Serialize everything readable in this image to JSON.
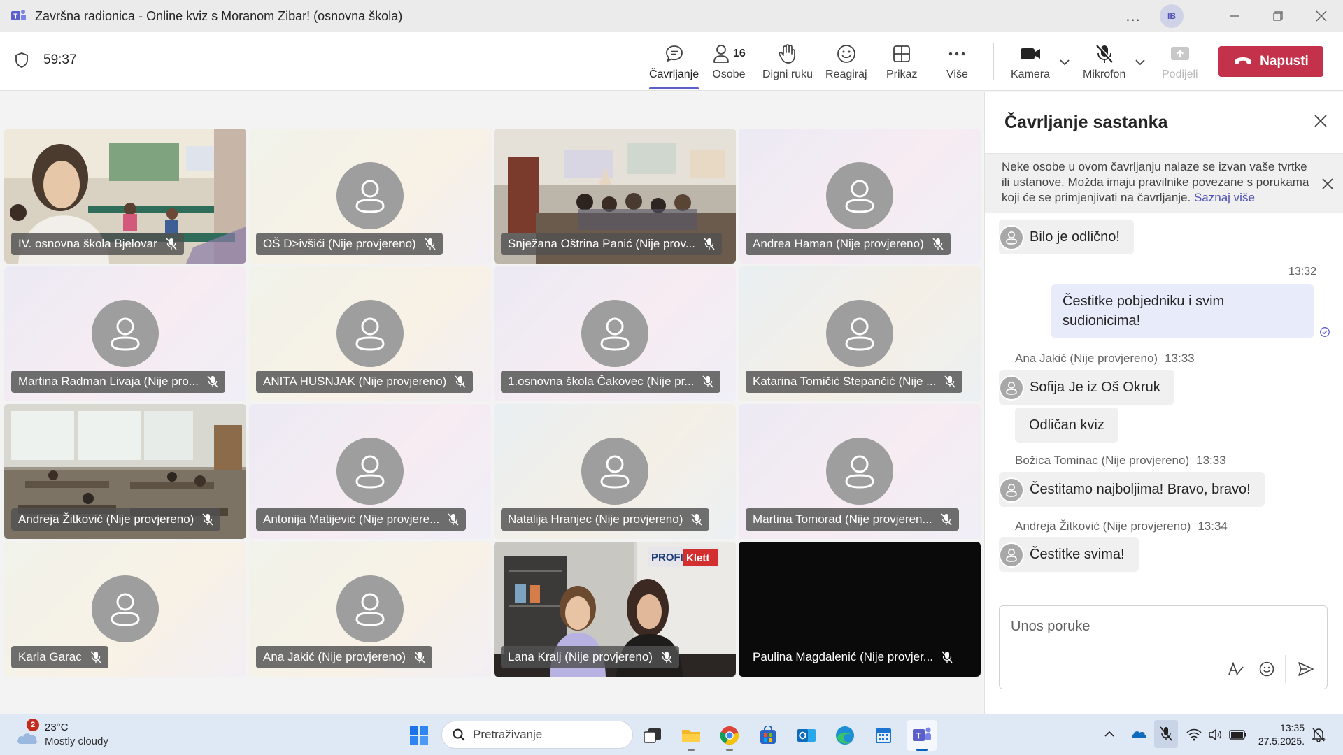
{
  "window": {
    "title": "Završna radionica - Online kviz s Moranom Zibar! (osnovna škola)",
    "more_label": "...",
    "user_initials": "IB"
  },
  "toolbar": {
    "timer": "59:37",
    "chat_label": "Čavrljanje",
    "people_label": "Osobe",
    "people_count": "16",
    "raise_hand_label": "Digni ruku",
    "react_label": "Reagiraj",
    "view_label": "Prikaz",
    "more_label": "Više",
    "camera_label": "Kamera",
    "mic_label": "Mikrofon",
    "share_label": "Podijeli",
    "leave_label": "Napusti"
  },
  "colors": {
    "accent": "#5b5fc7",
    "leave": "#c4314b",
    "bubble_out": "#e8ebfa"
  },
  "participants": [
    {
      "name": "IV. osnovna škola Bjelovar",
      "video": true
    },
    {
      "name": "OŠ D>ivšići (Nije provjereno)",
      "video": false
    },
    {
      "name": "Snježana Oštrina Panić (Nije prov...",
      "video": true
    },
    {
      "name": "Andrea Haman (Nije provjereno)",
      "video": false
    },
    {
      "name": "Martina Radman Livaja (Nije pro...",
      "video": false
    },
    {
      "name": "ANITA HUSNJAK (Nije provjereno)",
      "video": false
    },
    {
      "name": "1.osnovna škola Čakovec (Nije pr...",
      "video": false
    },
    {
      "name": "Katarina Tomičić Stepančić (Nije ...",
      "video": false
    },
    {
      "name": "Andreja Žitković (Nije provjereno)",
      "video": true
    },
    {
      "name": "Antonija Matijević (Nije provjere...",
      "video": false
    },
    {
      "name": "Natalija Hranjec (Nije provjereno)",
      "video": false
    },
    {
      "name": "Martina Tomorad (Nije provjeren...",
      "video": false
    },
    {
      "name": "Karla Garac",
      "video": false
    },
    {
      "name": "Ana Jakić (Nije provjereno)",
      "video": false
    },
    {
      "name": "Lana Kralj (Nije provjereno)",
      "video": true
    },
    {
      "name": "Paulina Magdalenić (Nije provjer...",
      "video": false
    }
  ],
  "video_text": {
    "profil_logo": "PROFIL Klett"
  },
  "chat": {
    "title": "Čavrljanje sastanka",
    "notice": "Neke osobe u ovom čavrljanju nalaze se izvan vaše tvrtke ili ustanove. Možda imaju pravilnike povezane s porukama koji će se primjenjivati na čavrljanje.",
    "notice_link": "Saznaj više",
    "messages": {
      "m1": {
        "text": "Bilo je odlično!"
      },
      "out": {
        "time": "13:32",
        "text": "Čestitke pobjedniku i svim sudionicima!"
      },
      "m2": {
        "author": "Ana Jakić (Nije provjereno)",
        "time": "13:33",
        "text": "Sofija Je iz Oš Okruk",
        "text2": "Odličan kviz"
      },
      "m3": {
        "author": "Božica Tominac (Nije provjereno)",
        "time": "13:33",
        "text": "Čestitamo najboljima! Bravo, bravo!"
      },
      "m4": {
        "author": "Andreja Žitković (Nije provjereno)",
        "time": "13:34",
        "text": "Čestitke svima!"
      }
    },
    "compose_placeholder": "Unos poruke"
  },
  "taskbar": {
    "weather_badge": "2",
    "weather_temp": "23°C",
    "weather_condition": "Mostly cloudy",
    "search_placeholder": "Pretraživanje",
    "time": "13:35",
    "date": "27.5.2025."
  }
}
